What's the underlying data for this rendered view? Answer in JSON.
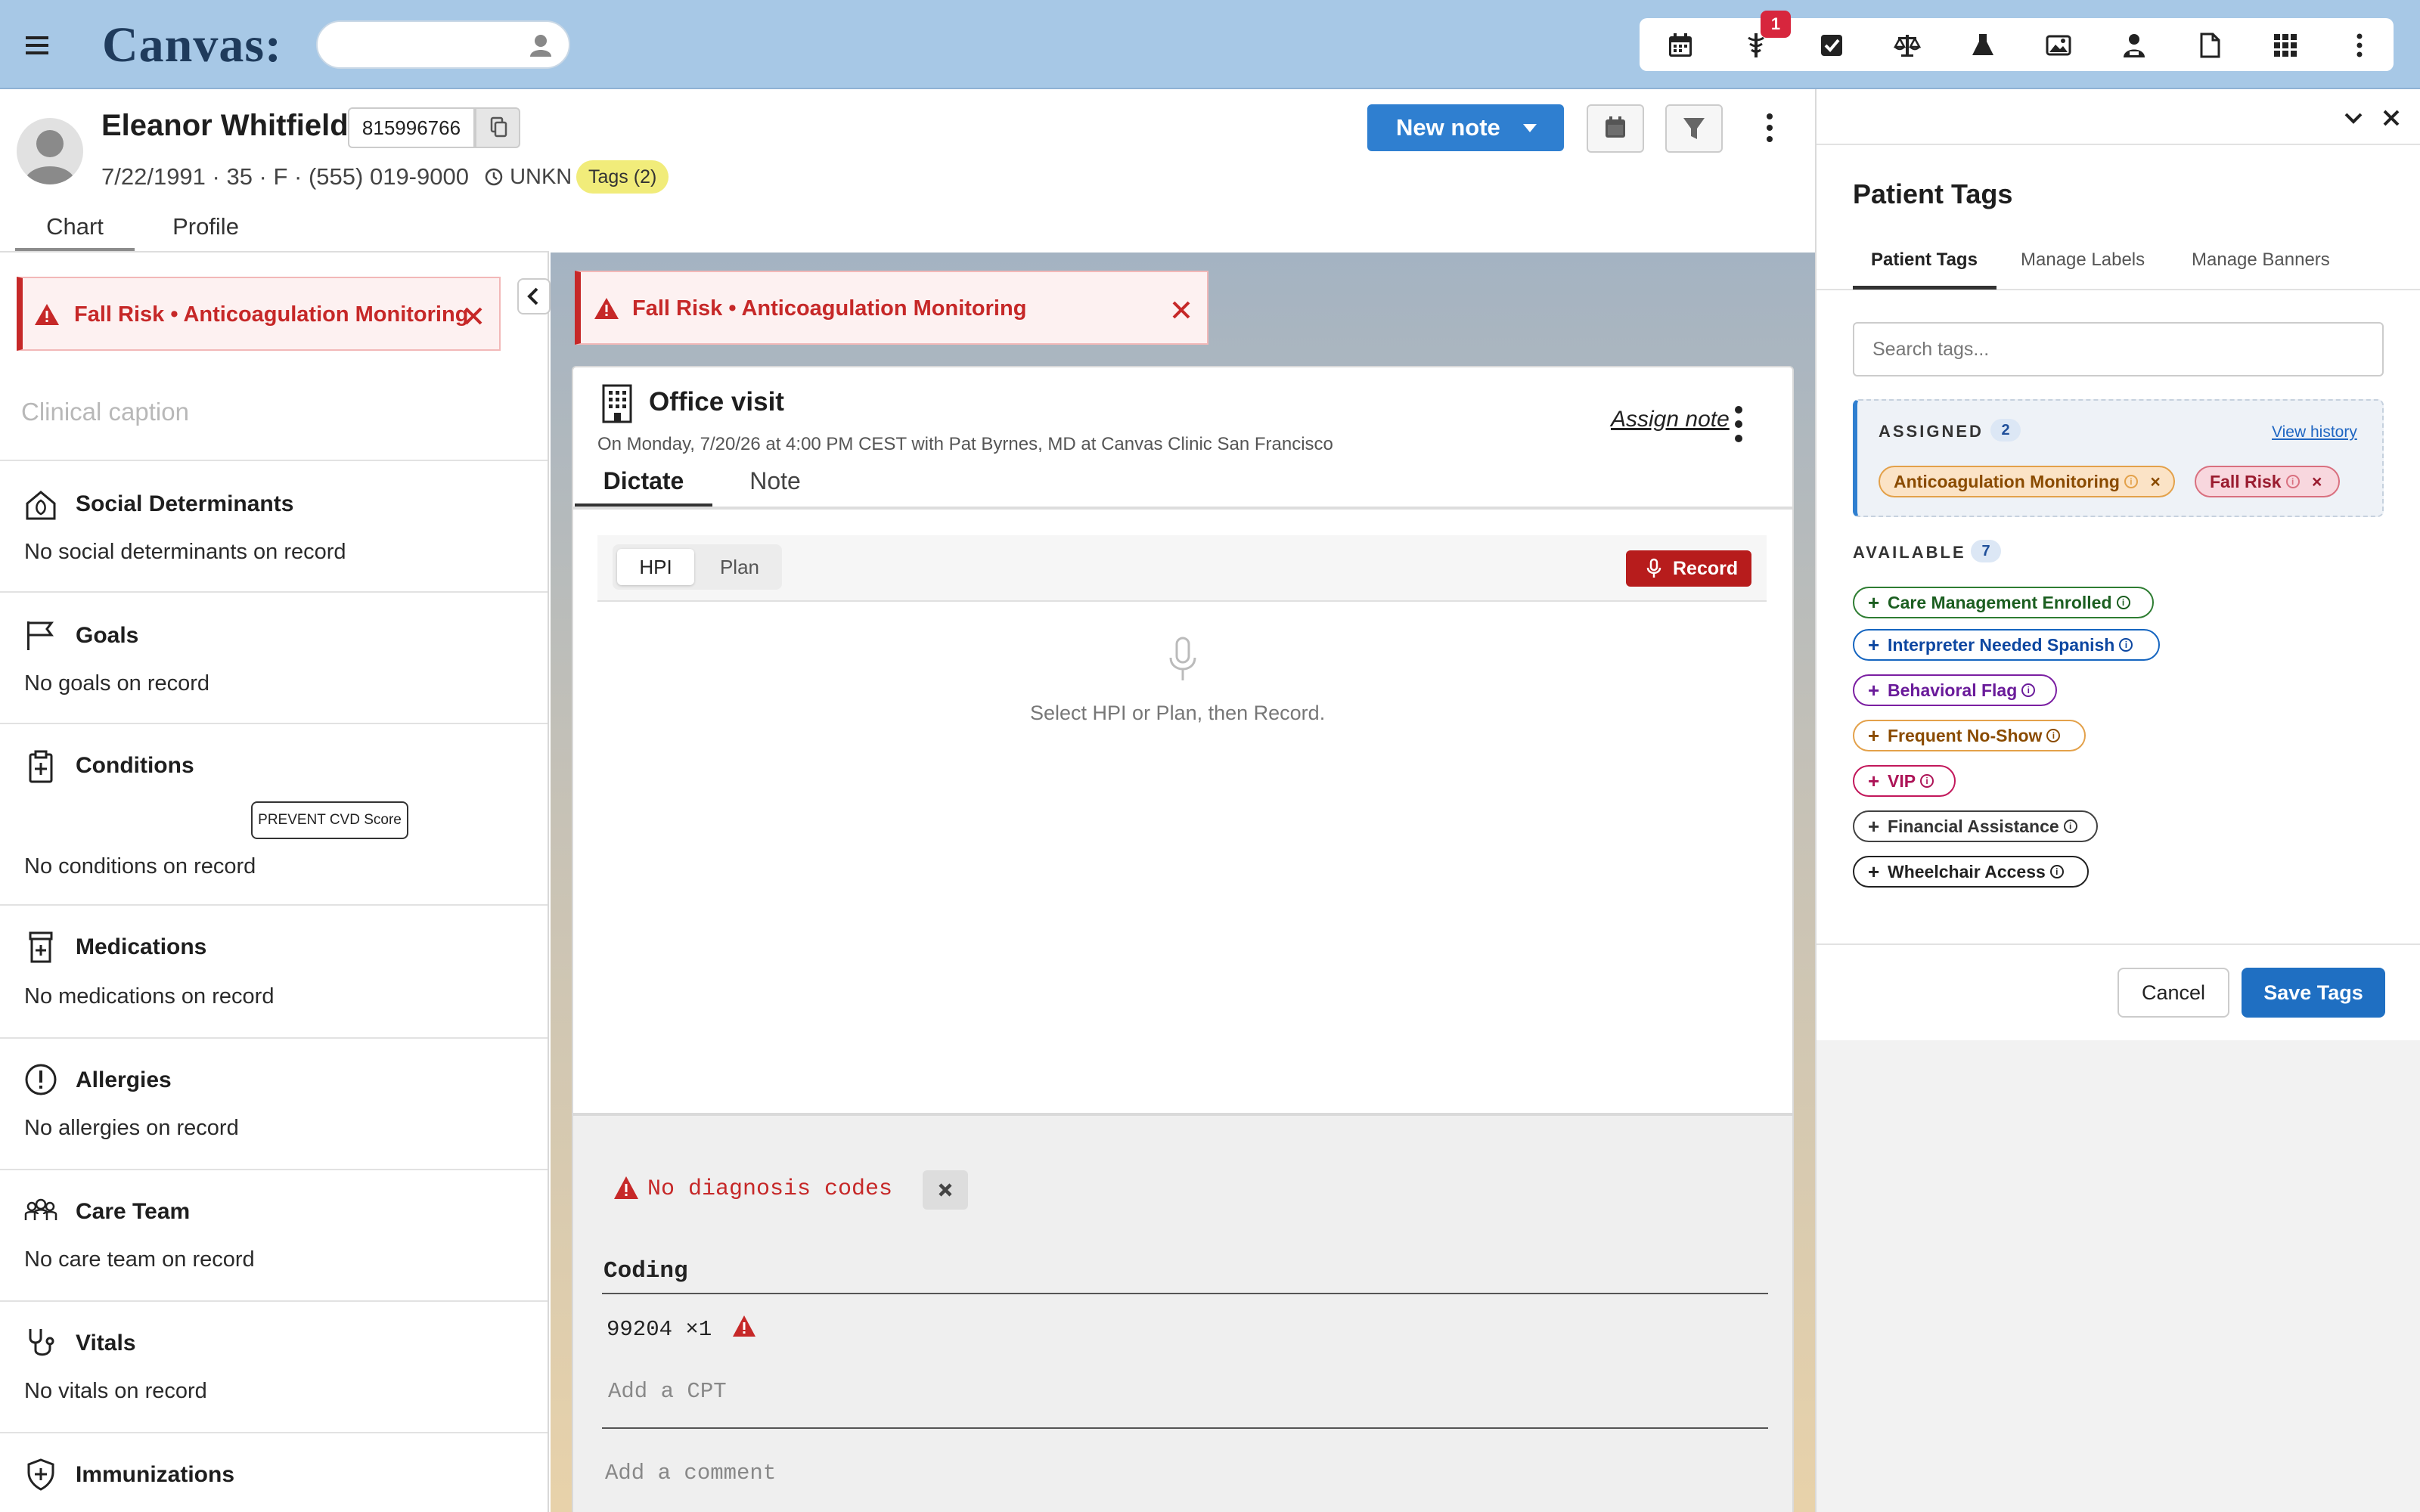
{
  "app": {
    "logo": "Canvas:"
  },
  "topbar": {
    "icons": [
      "calendar-icon",
      "caduceus-icon",
      "checkbox-icon",
      "scales-icon",
      "flask-icon",
      "image-icon",
      "user-badge-icon",
      "document-icon",
      "apps-grid-icon",
      "more-vertical-icon"
    ],
    "notification_count": "1"
  },
  "patient": {
    "name": "Eleanor Whitfield",
    "id": "815996766",
    "meta": "7/22/1991 · 35 · F · (555) 019-9000",
    "status": "UNKN",
    "tags_chip": "Tags (2)"
  },
  "chart_tabs": {
    "chart": "Chart",
    "profile": "Profile"
  },
  "header_actions": {
    "new_note": "New note"
  },
  "alert": {
    "text": "Fall Risk • Anticoagulation Monitoring"
  },
  "left_panel": {
    "caption_placeholder": "Clinical caption",
    "sections": [
      {
        "title": "Social Determinants",
        "empty": "No social determinants on record"
      },
      {
        "title": "Goals",
        "empty": "No goals on record"
      },
      {
        "title": "Conditions",
        "empty": "No conditions on record"
      },
      {
        "title": "Medications",
        "empty": "No medications on record"
      },
      {
        "title": "Allergies",
        "empty": "No allergies on record"
      },
      {
        "title": "Care Team",
        "empty": "No care team on record"
      },
      {
        "title": "Vitals",
        "empty": "No vitals on record"
      },
      {
        "title": "Immunizations",
        "empty": ""
      }
    ],
    "prevent_button": "PREVENT CVD Score"
  },
  "note": {
    "title": "Office visit",
    "subtitle": "On Monday, 7/20/26 at 4:00 PM CEST with Pat Byrnes, MD at Canvas Clinic San Francisco",
    "assign": "Assign note",
    "tabs": {
      "dictate": "Dictate",
      "note": "Note"
    },
    "segments": {
      "hpi": "HPI",
      "plan": "Plan"
    },
    "record": "Record",
    "hint": "Select HPI or Plan, then Record.",
    "no_dx": "No diagnosis codes",
    "coding_title": "Coding",
    "cpt_value": "99204 ×1",
    "add_cpt": "Add a CPT",
    "add_comment": "Add a comment"
  },
  "right_panel": {
    "title": "Patient Tags",
    "tabs": [
      "Patient Tags",
      "Manage Labels",
      "Manage Banners"
    ],
    "search_placeholder": "Search tags...",
    "assigned_label": "ASSIGNED",
    "assigned_count": "2",
    "view_history": "View history",
    "assigned": [
      {
        "label": "Anticoagulation Monitoring",
        "color": "#c77700"
      },
      {
        "label": "Fall Risk",
        "color": "#b3263a"
      }
    ],
    "available_label": "AVAILABLE",
    "available_count": "7",
    "available": [
      {
        "label": "Care Management Enrolled",
        "color": "#2e7d32"
      },
      {
        "label": "Interpreter Needed Spanish",
        "color": "#1565c0"
      },
      {
        "label": "Behavioral Flag",
        "color": "#7b1fa2"
      },
      {
        "label": "Frequent No-Show",
        "color": "#c77700"
      },
      {
        "label": "VIP",
        "color": "#c2185b"
      },
      {
        "label": "Financial Assistance",
        "color": "#424242"
      },
      {
        "label": "Wheelchair Access",
        "color": "#212121"
      }
    ],
    "cancel": "Cancel",
    "save": "Save Tags"
  },
  "colors": {
    "topbar": "#a7c8e6",
    "primary": "#2f7fd0",
    "danger": "#c62828",
    "tags_chip": "#f1ec7a"
  }
}
